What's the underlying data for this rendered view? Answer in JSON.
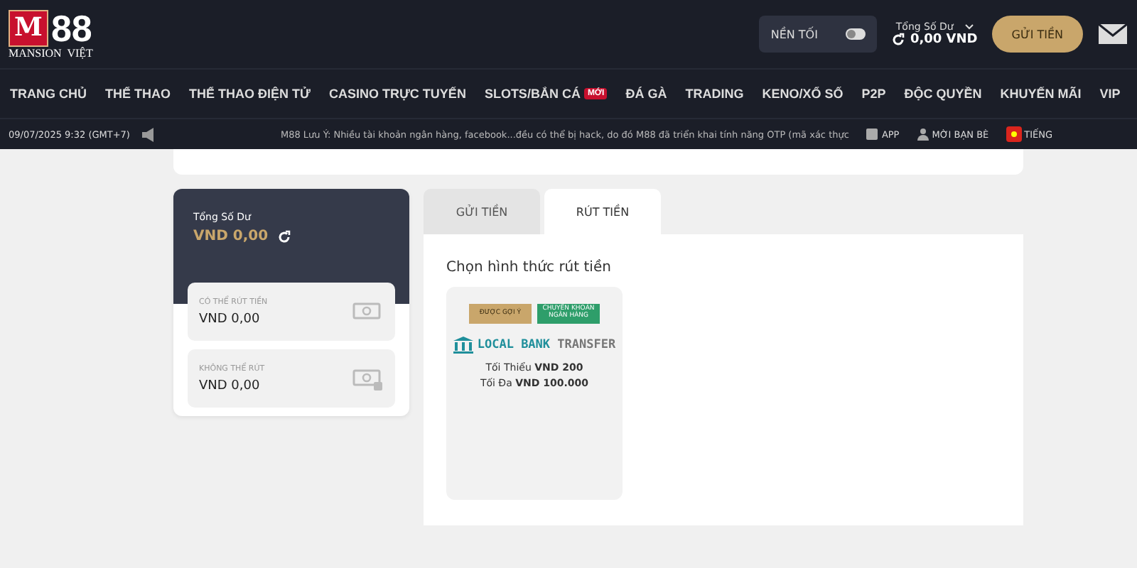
{
  "header": {
    "logo_mark": "M",
    "logo_text": "88",
    "logo_sub": "MANSION  VIỆT",
    "theme_toggle": {
      "label": "NỀN TỐI",
      "on": false
    },
    "balance_label": "Tổng Số Dư",
    "balance": "0,00 VND",
    "deposit_button": "GỬI TIỀN"
  },
  "nav": [
    {
      "label": "TRANG CHỦ"
    },
    {
      "label": "THỂ THAO"
    },
    {
      "label": "THỂ THAO ĐIỆN TỬ"
    },
    {
      "label": "CASINO TRỰC TUYẾN"
    },
    {
      "label": "SLOTS/BẮN CÁ",
      "badge": "MỚI"
    },
    {
      "label": "ĐÁ GÀ"
    },
    {
      "label": "TRADING"
    },
    {
      "label": "KENO/XỔ SỐ"
    },
    {
      "label": "P2P"
    },
    {
      "label": "ĐỘC QUYỀN"
    },
    {
      "label": "KHUYẾN MÃI"
    },
    {
      "label": "VIP"
    }
  ],
  "ticker": {
    "datetime": "09/07/2025 9:32 (GMT+7)",
    "message": "M88 Lưu Ý: Nhiều tài khoản ngân hàng, facebook...đều có thể bị hack, do đó M88 đã triển khai tính năng OTP (mã xác thực",
    "links": [
      "APP",
      "MỜI BẠN BÈ",
      "TIẾNG"
    ]
  },
  "wallet": {
    "label": "Tổng Số Dư",
    "amount": "VND 0,00",
    "items": [
      {
        "label": "CÓ THỂ RÚT TIỀN",
        "amount": "VND 0,00",
        "locked": false
      },
      {
        "label": "KHÔNG THỂ RÚT",
        "amount": "VND 0,00",
        "locked": true
      }
    ]
  },
  "tabs": [
    {
      "label": "GỬI TIỀN",
      "selected": false
    },
    {
      "label": "RÚT TIỀN",
      "selected": true
    }
  ],
  "method_heading": "Chọn hình thức rút tiền",
  "methods": [
    {
      "tags": [
        {
          "label": "ĐƯỢC GỢI Ý",
          "color": "#c9a66b"
        },
        {
          "label": "CHUYỂN KHOẢN NGÂN HÀNG",
          "color": "#2e9e6a"
        }
      ],
      "name_strong": "LOCAL BANK",
      "name_light": "TRANSFER",
      "min_label": "Tối Thiểu",
      "min": "VND 200",
      "max_label": "Tối Đa",
      "max": "VND 100.000"
    }
  ]
}
